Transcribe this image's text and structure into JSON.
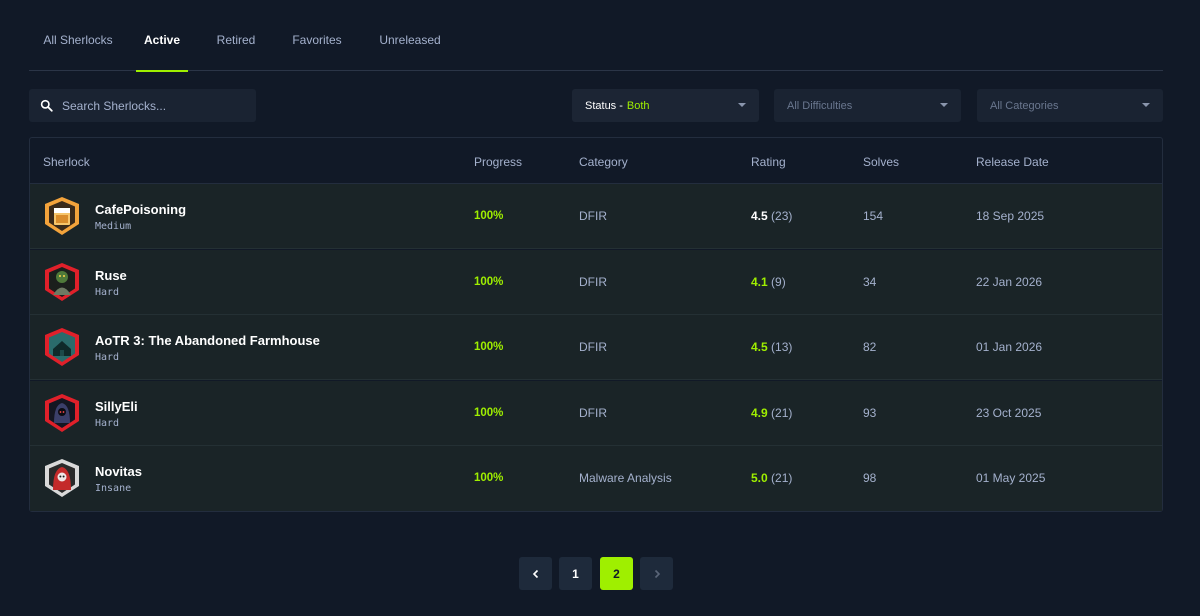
{
  "tabs": [
    {
      "label": "All Sherlocks"
    },
    {
      "label": "Active"
    },
    {
      "label": "Retired"
    },
    {
      "label": "Favorites"
    },
    {
      "label": "Unreleased"
    }
  ],
  "active_tab": "Active",
  "search": {
    "placeholder": "Search Sherlocks..."
  },
  "filters": {
    "status_label": "Status -",
    "status_value": "Both",
    "difficulty": "All Difficulties",
    "category": "All Categories"
  },
  "table": {
    "headers": [
      "Sherlock",
      "Progress",
      "Category",
      "Rating",
      "Solves",
      "Release Date"
    ],
    "rows": [
      {
        "name": "CafePoisoning",
        "difficulty": "Medium",
        "progress": "100%",
        "category": "DFIR",
        "rating": "4.5",
        "rating_count": "(23)",
        "solves": "154",
        "release": "18 Sep 2025",
        "avatar_color": "#f3a33b",
        "avatar_icon": "coffee-cup-icon"
      },
      {
        "name": "Ruse",
        "difficulty": "Hard",
        "progress": "100%",
        "category": "DFIR",
        "rating": "4.1",
        "rating_count": "(9)",
        "solves": "34",
        "release": "22 Jan 2026",
        "avatar_color": "#e0202a",
        "avatar_icon": "goblin-icon"
      },
      {
        "name": "AoTR 3: The Abandoned Farmhouse",
        "difficulty": "Hard",
        "progress": "100%",
        "category": "DFIR",
        "rating": "4.5",
        "rating_count": "(13)",
        "solves": "82",
        "release": "01 Jan 2026",
        "avatar_color": "#e0202a",
        "avatar_icon": "farmhouse-icon"
      },
      {
        "name": "SillyEli",
        "difficulty": "Hard",
        "progress": "100%",
        "category": "DFIR",
        "rating": "4.9",
        "rating_count": "(21)",
        "solves": "93",
        "release": "23 Oct 2025",
        "avatar_color": "#e0202a",
        "avatar_icon": "hooded-figure-icon"
      },
      {
        "name": "Novitas",
        "difficulty": "Insane",
        "progress": "100%",
        "category": "Malware Analysis",
        "rating": "5.0",
        "rating_count": "(21)",
        "solves": "98",
        "release": "01 May 2025",
        "avatar_color": "#d9d9d9",
        "avatar_icon": "reaper-icon"
      }
    ]
  },
  "pagination": {
    "prev": "‹",
    "pages": [
      "1",
      "2"
    ],
    "current": "2",
    "next": "›"
  },
  "colors": {
    "accent": "#9fef00",
    "background": "#111927",
    "row": "#1a2427"
  }
}
